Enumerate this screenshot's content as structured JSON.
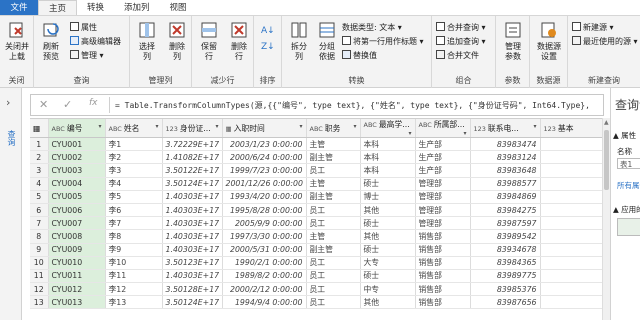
{
  "tabs": [
    {
      "label": "文件"
    },
    {
      "label": "主页"
    },
    {
      "label": "转换"
    },
    {
      "label": "添加列"
    },
    {
      "label": "视图"
    }
  ],
  "ribbon": {
    "close": {
      "btn": "关闭并\n上载",
      "group": "关闭"
    },
    "query": {
      "refresh": "刷新\n预览",
      "props": "属性",
      "adv": "高级编辑器",
      "manage": "管理",
      "group": "查询"
    },
    "managecols": {
      "choose": "选择\n列",
      "remove": "删除\n列",
      "group": "管理列"
    },
    "reducerows": {
      "keep": "保留\n行",
      "remove": "删除\n行",
      "group": "减少行"
    },
    "sort": {
      "group": "排序"
    },
    "transform": {
      "split": "拆分\n列",
      "groupby": "分组\n依据",
      "dtype": "数据类型: 文本",
      "firstrow": "将第一行用作标题",
      "replace": "替换值",
      "group": "转换"
    },
    "combine": {
      "merge": "合并查询",
      "append": "追加查询",
      "files": "合并文件",
      "group": "组合"
    },
    "params": {
      "manage": "管理\n参数",
      "group": "参数"
    },
    "datasource": {
      "settings": "数据源\n设置",
      "group": "数据源"
    },
    "newquery": {
      "new": "新建源",
      "recent": "最近使用的源",
      "group": "新建查询"
    }
  },
  "leftpane": {
    "label": "查询"
  },
  "formula": {
    "text": "= Table.TransformColumnTypes(源,{{\"编号\", type text}, {\"姓名\", type text}, {\"身份证号码\", Int64.Type},"
  },
  "rightpane": {
    "title": "查询设置",
    "props": "属性",
    "name_label": "名称",
    "name_value": "表1",
    "all_props": "所有属性",
    "steps": "应用的步骤"
  },
  "columns": [
    {
      "type": "ABC",
      "name": "编号"
    },
    {
      "type": "ABC",
      "name": "姓名"
    },
    {
      "type": "123",
      "name": "身份证..."
    },
    {
      "type": "▦",
      "name": "入职时间"
    },
    {
      "type": "ABC",
      "name": "职务"
    },
    {
      "type": "ABC",
      "name": "最高学..."
    },
    {
      "type": "ABC",
      "name": "所属部..."
    },
    {
      "type": "123",
      "name": "联系电..."
    },
    {
      "type": "123",
      "name": "基本"
    }
  ],
  "rows": [
    [
      "1",
      "CYU001",
      "李1",
      "3.72229E+17",
      "2003/1/23 0:00:00",
      "主管",
      "本科",
      "生产部",
      "83983474",
      ""
    ],
    [
      "2",
      "CYU002",
      "李2",
      "1.41082E+17",
      "2000/6/24 0:00:00",
      "副主管",
      "本科",
      "生产部",
      "83983124",
      ""
    ],
    [
      "3",
      "CYU003",
      "李3",
      "3.50122E+17",
      "1999/7/23 0:00:00",
      "员工",
      "本科",
      "生产部",
      "83983648",
      ""
    ],
    [
      "4",
      "CYU004",
      "李4",
      "3.50124E+17",
      "2001/12/26 0:00:00",
      "主管",
      "硕士",
      "管理部",
      "83988577",
      ""
    ],
    [
      "5",
      "CYU005",
      "李5",
      "1.40303E+17",
      "1993/4/20 0:00:00",
      "副主管",
      "博士",
      "管理部",
      "83984869",
      ""
    ],
    [
      "6",
      "CYU006",
      "李6",
      "1.40303E+17",
      "1995/8/28 0:00:00",
      "员工",
      "其他",
      "管理部",
      "83984275",
      ""
    ],
    [
      "7",
      "CYU007",
      "李7",
      "1.40303E+17",
      "2005/9/9 0:00:00",
      "员工",
      "硕士",
      "管理部",
      "83987597",
      ""
    ],
    [
      "8",
      "CYU008",
      "李8",
      "1.40303E+17",
      "1997/3/30 0:00:00",
      "主管",
      "其他",
      "销售部",
      "83989542",
      ""
    ],
    [
      "9",
      "CYU009",
      "李9",
      "1.40303E+17",
      "2000/5/31 0:00:00",
      "副主管",
      "硕士",
      "销售部",
      "83934678",
      ""
    ],
    [
      "10",
      "CYU010",
      "李10",
      "3.50123E+17",
      "1990/2/1 0:00:00",
      "员工",
      "大专",
      "销售部",
      "83984365",
      ""
    ],
    [
      "11",
      "CYU011",
      "李11",
      "1.40303E+17",
      "1989/8/2 0:00:00",
      "员工",
      "硕士",
      "销售部",
      "83989775",
      ""
    ],
    [
      "12",
      "CYU012",
      "李12",
      "3.50128E+17",
      "2000/2/12 0:00:00",
      "员工",
      "中专",
      "销售部",
      "83985376",
      ""
    ],
    [
      "13",
      "CYU013",
      "李13",
      "3.50124E+17",
      "1994/9/4 0:00:00",
      "员工",
      "其他",
      "销售部",
      "83987656",
      ""
    ]
  ],
  "colors": {
    "accent": "#2b73c6",
    "selected_col": "#dcefdc"
  }
}
